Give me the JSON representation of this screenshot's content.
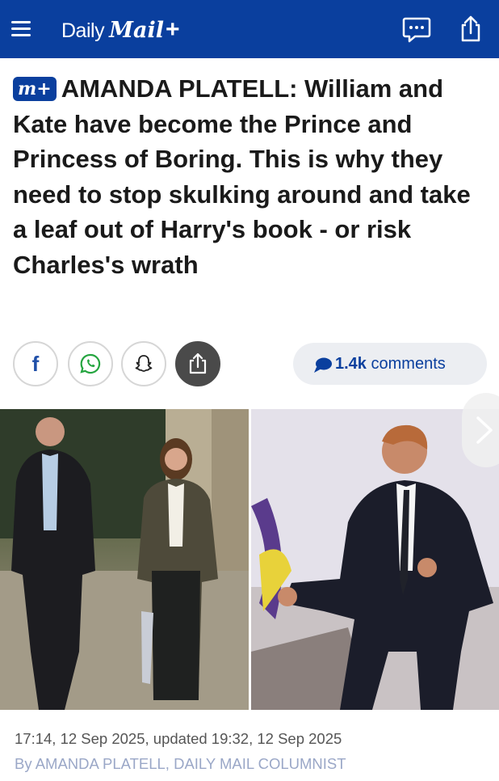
{
  "header": {
    "logo_daily": "Daily",
    "logo_mail": "Mail",
    "logo_plus": "+",
    "background_color": "#0a3f9e"
  },
  "article": {
    "badge": "m+",
    "headline": "AMANDA PLATELL: William and Kate have become the Prince and Princess of Boring. This is why they need to stop skulking around and take a leaf out of Harry's book - or risk Charles's wrath"
  },
  "social": {
    "buttons": [
      "facebook-icon",
      "whatsapp-icon",
      "snapchat-icon",
      "share-icon"
    ],
    "comments_count": "1.4k",
    "comments_label": "comments"
  },
  "meta": {
    "timestamp": "17:14, 12 Sep 2025, updated 19:32, 12 Sep 2025",
    "by_prefix": "By",
    "author": "AMANDA PLATELL, DAILY MAIL COLUMNIST"
  }
}
